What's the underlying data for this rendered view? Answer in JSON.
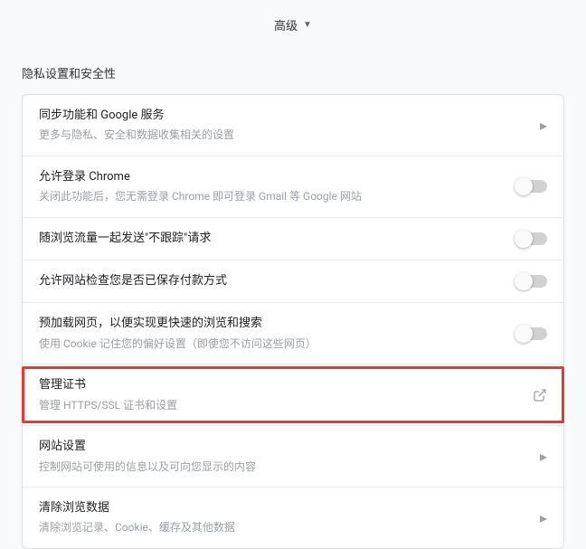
{
  "advanced_label": "高级",
  "section_title": "隐私设置和安全性",
  "rows": [
    {
      "title": "同步功能和 Google 服务",
      "subtitle": "更多与隐私、安全和数据收集相关的设置",
      "action": "arrow"
    },
    {
      "title": "允许登录 Chrome",
      "subtitle": "关闭此功能后，您无需登录 Chrome 即可登录 Gmail 等 Google 网站",
      "action": "toggle"
    },
    {
      "title": "随浏览流量一起发送\"不跟踪\"请求",
      "subtitle": "",
      "action": "toggle"
    },
    {
      "title": "允许网站检查您是否已保存付款方式",
      "subtitle": "",
      "action": "toggle"
    },
    {
      "title": "预加载网页，以便实现更快速的浏览和搜索",
      "subtitle": "使用 Cookie 记住您的偏好设置（即使您不访问这些网页）",
      "action": "toggle"
    },
    {
      "title": "管理证书",
      "subtitle": "管理 HTTPS/SSL 证书和设置",
      "action": "external"
    },
    {
      "title": "网站设置",
      "subtitle": "控制网站可使用的信息以及可向您显示的内容",
      "action": "arrow"
    },
    {
      "title": "清除浏览数据",
      "subtitle": "清除浏览记录、Cookie、缓存及其他数据",
      "action": "arrow"
    }
  ]
}
